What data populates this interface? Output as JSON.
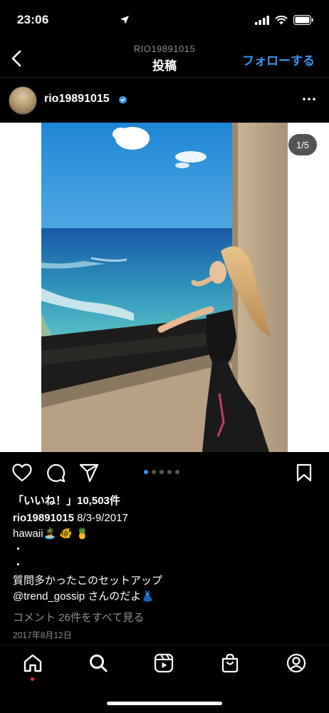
{
  "status_bar": {
    "time": "23:06"
  },
  "header": {
    "subtitle": "RIO19891015",
    "title": "投稿",
    "follow_label": "フォローする"
  },
  "post": {
    "username": "rio19891015",
    "image_counter": "1/5",
    "carousel": {
      "count": 5,
      "active_index": 0
    },
    "likes_text": "「いいね！」10,503件",
    "caption_username": "rio19891015",
    "caption_first": "8/3-9/2017",
    "caption_lines": [
      "hawaii🏝️ 🐠 🍍",
      "・",
      "・",
      "質問多かったこのセットアップ",
      "@trend_gossip さんのだよ👗"
    ],
    "view_comments": "コメント 26件をすべて見る",
    "date": "2017年8月12日"
  },
  "icons": {
    "back": "chevron-left-icon",
    "verified": "verified-badge-icon",
    "more": "more-options-icon",
    "like": "heart-icon",
    "comment": "comment-icon",
    "share": "send-icon",
    "save": "bookmark-icon",
    "home": "home-icon",
    "search": "search-icon",
    "reels": "reels-icon",
    "shop": "shop-icon",
    "profile": "profile-icon"
  },
  "colors": {
    "accent": "#3797f0",
    "background": "#000000",
    "muted": "#8e8e8e",
    "notification": "#ff3040"
  }
}
